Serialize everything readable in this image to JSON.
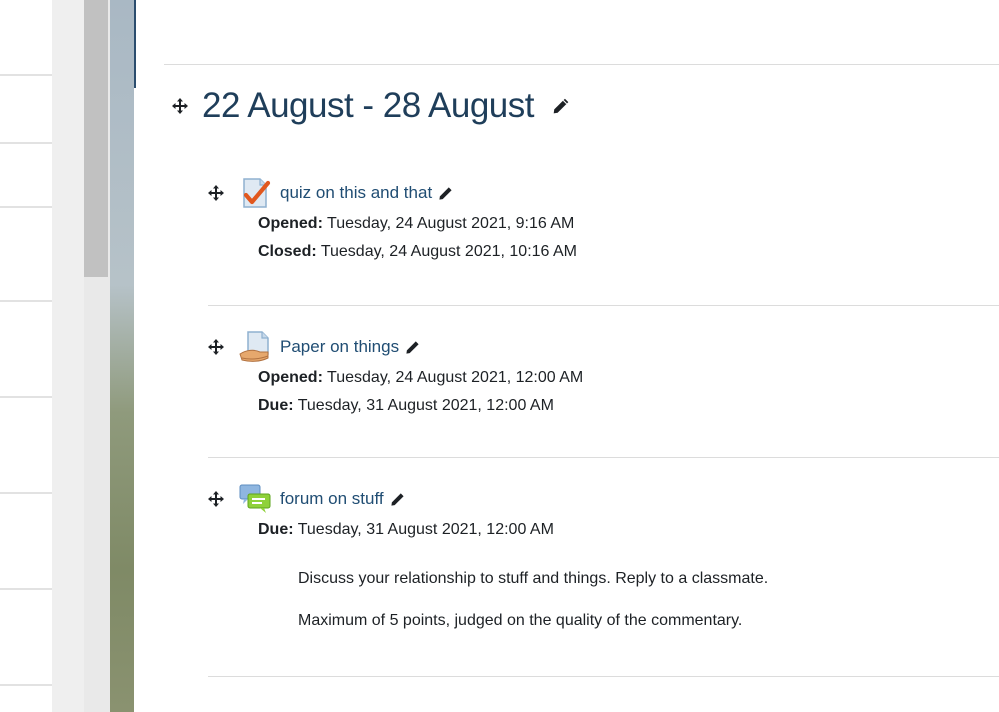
{
  "section": {
    "title": "22 August - 28 August"
  },
  "activities": [
    {
      "name": "quiz on this and that",
      "icon": "quiz-icon",
      "dates": [
        {
          "label": "Opened:",
          "value": " Tuesday, 24 August 2021, 9:16 AM"
        },
        {
          "label": "Closed:",
          "value": " Tuesday, 24 August 2021, 10:16 AM"
        }
      ]
    },
    {
      "name": "Paper on things",
      "icon": "assignment-icon",
      "dates": [
        {
          "label": "Opened:",
          "value": " Tuesday, 24 August 2021, 12:00 AM"
        },
        {
          "label": "Due:",
          "value": " Tuesday, 31 August 2021, 12:00 AM"
        }
      ]
    },
    {
      "name": "forum on stuff",
      "icon": "forum-icon",
      "dates": [
        {
          "label": "Due:",
          "value": " Tuesday, 31 August 2021, 12:00 AM"
        }
      ],
      "description": [
        "Discuss your relationship to stuff and things. Reply to a classmate.",
        "Maximum of 5 points, judged on the quality of the commentary."
      ]
    }
  ],
  "colors": {
    "title": "#1f3e5a",
    "link": "#204d73",
    "text": "#1d2125",
    "separator": "#dcdcdc"
  }
}
